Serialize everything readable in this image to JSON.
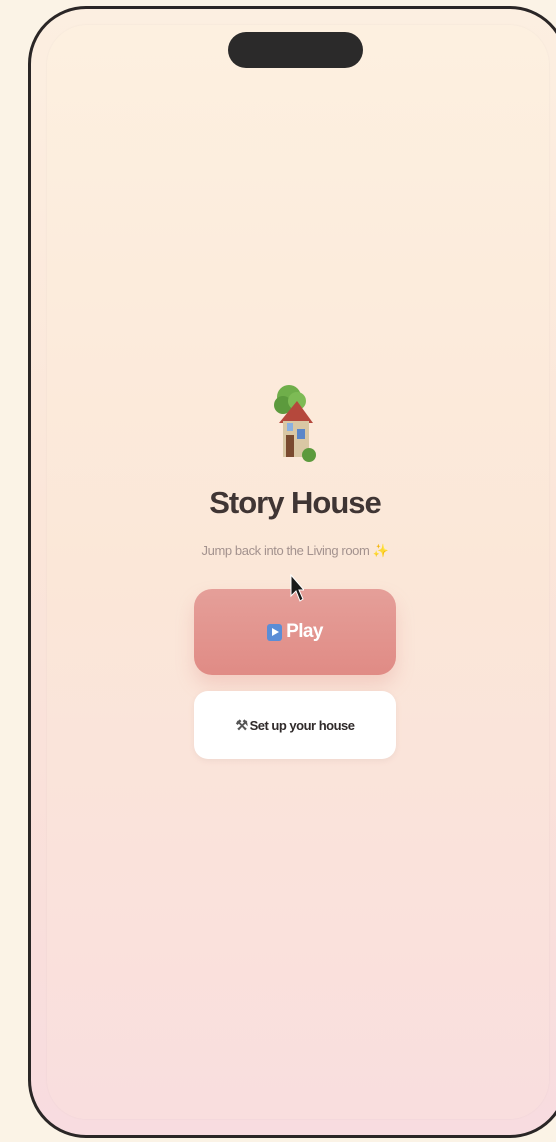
{
  "app": {
    "title": "Story House",
    "subtitle": "Jump back into the Living room",
    "subtitle_emoji": "✨"
  },
  "actions": {
    "play_label": "Play",
    "setup_label": "Set up your house"
  },
  "icons": {
    "logo": "house-with-tree-icon",
    "play": "play-button-icon",
    "setup": "hammer-and-wrench-icon",
    "cursor": "mouse-pointer-icon"
  },
  "colors": {
    "accent": "#e08b85",
    "title": "#3f3534",
    "subtitle": "#a3928e",
    "phone_frame": "#2a2626"
  }
}
